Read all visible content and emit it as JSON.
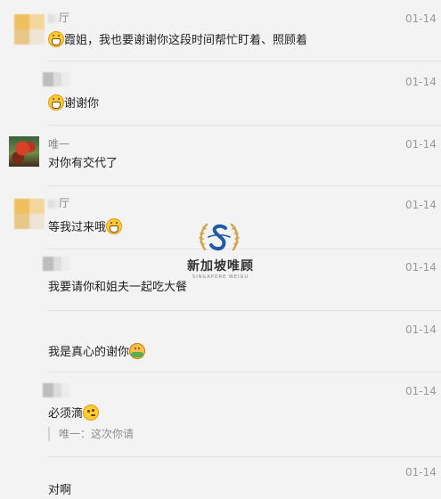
{
  "comments": [
    {
      "author_name": "",
      "author_suffix": "厅",
      "emoji_before": "grinning-face",
      "text": "霞姐，我也要谢谢你这段时间帮忙盯着、照顾着",
      "emoji_after": "",
      "time": "01-14"
    },
    {
      "author_name": "",
      "author_suffix": "",
      "emoji_before": "grinning-face",
      "text": "谢谢你",
      "emoji_after": "",
      "time": "01-14"
    },
    {
      "author_name": "唯一",
      "author_suffix": "",
      "emoji_before": "",
      "text": "对你有交代了",
      "emoji_after": "",
      "time": "01-14"
    },
    {
      "author_name": "",
      "author_suffix": "厅",
      "emoji_before": "",
      "text": "等我过来哦",
      "emoji_after": "grinning-face",
      "time": "01-14"
    },
    {
      "author_name": "",
      "author_suffix": "",
      "emoji_before": "",
      "text": "我要请你和姐夫一起吃大餐",
      "emoji_after": "",
      "time": "01-14"
    },
    {
      "author_name": "",
      "author_suffix": "",
      "emoji_before": "",
      "text": "我是真心的谢你",
      "emoji_after": "hugging-face",
      "time": "01-14"
    },
    {
      "author_name": "",
      "author_suffix": "",
      "emoji_before": "",
      "text": "必须滴",
      "emoji_after": "thinking-face",
      "time": "01-14",
      "quote": "唯一：这次你请"
    },
    {
      "author_name": "",
      "author_suffix": "",
      "emoji_before": "",
      "text": "对啊",
      "emoji_after": "",
      "time": "01-14"
    }
  ],
  "watermark": {
    "name": "新加坡唯顾",
    "subtitle": "SINGAPORE WEIGU",
    "colors": {
      "gold": "#d2a54a",
      "blue": "#1e5aa8"
    }
  },
  "colors": {
    "background": "#f3f3f3",
    "text": "#222222",
    "meta": "#9a9a9a",
    "emoji": "#ffcc33"
  }
}
